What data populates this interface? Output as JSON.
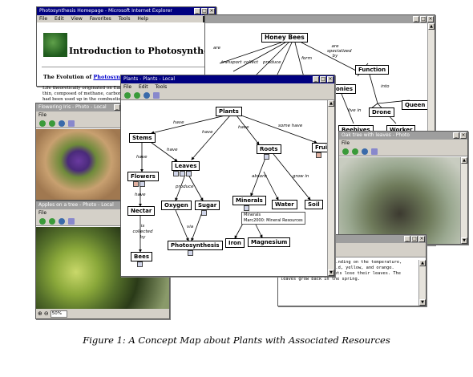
{
  "browser": {
    "title": "Photosynthesis Homepage - Microsoft Internet Explorer",
    "menu": [
      "File",
      "Edit",
      "View",
      "Favorites",
      "Tools",
      "Help"
    ],
    "heading": "Introduction to Photosynthesis",
    "subheading_prefix": "The Evolution of",
    "subheading_link": "Photosynthesis",
    "body_lines": [
      "Life theoretically originated on Earth 3.5 b",
      "thin, composed of methane, carbon dioxid",
      "had been used up in the combustion (or o"
    ]
  },
  "bees_map": {
    "title": "",
    "center": "Honey Bees",
    "function": "Function",
    "into": "into",
    "drone": "Drone",
    "queen": "Queen",
    "beehives": "Beehives",
    "worker": "Worker",
    "honies": "...onies",
    "labels": [
      "are",
      "transport",
      "collect",
      "produce",
      "form",
      "are specialized by",
      "live in",
      "are"
    ]
  },
  "flower_win": {
    "title": "Flowering Iris - Photo - Local",
    "menu": [
      "File"
    ]
  },
  "apples_win": {
    "title": "Apples on a tree - Photo - Local",
    "menu": [
      "File"
    ],
    "zoom": "50%"
  },
  "tree_win": {
    "title": "Oak tree with leaves - Photo",
    "menu": [
      "File"
    ]
  },
  "text_win": {
    "lines": [
      "...nding on the temperature,",
      "...d, yellow, and orange.",
      "During the winter plants lose their leaves. The",
      "leaves grow back in the spring."
    ]
  },
  "plants_map": {
    "title": "Plants - Plants - Local",
    "menu": [
      "File",
      "Edit",
      "Tools"
    ],
    "nodes": {
      "plants": "Plants",
      "stems": "Stems",
      "leaves": "Leaves",
      "roots": "Roots",
      "fruit": "Fruit",
      "flowers": "Flowers",
      "nectar": "Nectar",
      "bees": "Bees",
      "oxygen": "Oxygen",
      "sugar": "Sugar",
      "photosynthesis": "Photosynthesis",
      "minerals": "Minerals",
      "water": "Water",
      "soil": "Soil",
      "iron": "Iron",
      "magnesium": "Magnesium"
    },
    "edges": {
      "have1": "have",
      "have2": "have",
      "have3": "have",
      "some_have": "some have",
      "have4": "have",
      "have5": "have",
      "have6": "have",
      "is_collected_by": "is collected by",
      "produce": "produce",
      "via": "via",
      "absorb": "absorb",
      "grow_in": "grow in"
    },
    "callout_title": "Minerals",
    "callout_item": "Marc2000: Mineral Resources"
  },
  "caption": "Figure 1: A Concept Map about Plants with Associated Resources"
}
